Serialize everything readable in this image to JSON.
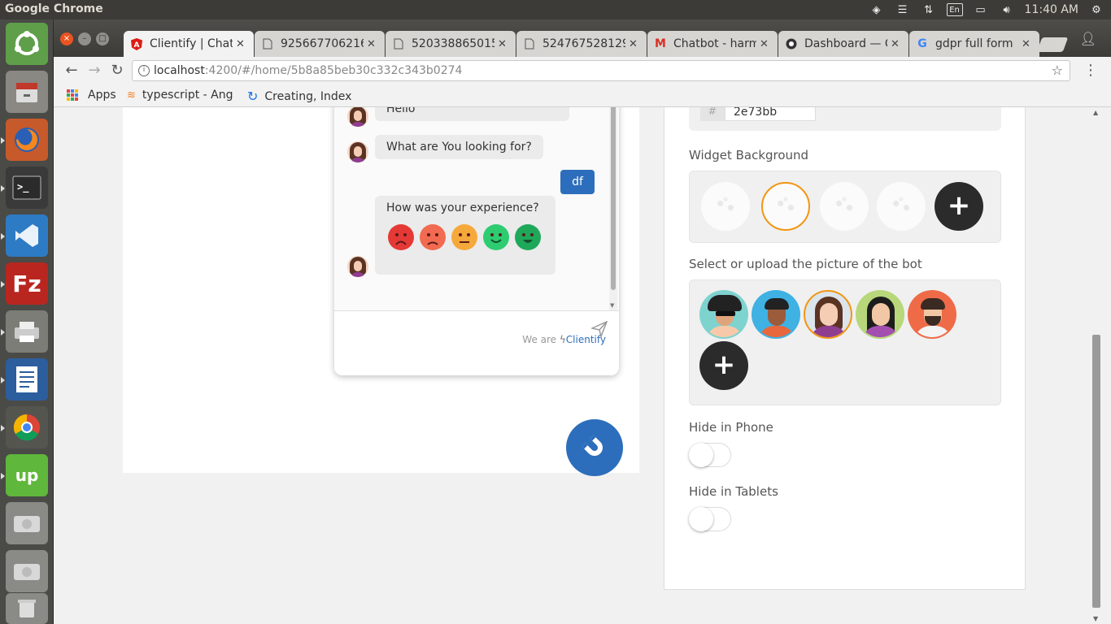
{
  "top_panel": {
    "app_name": "Google Chrome",
    "keyboard_layout": "En",
    "time": "11:40 AM"
  },
  "tabs": [
    {
      "label": "Clientify | Chatb",
      "favicon": "angular-icon",
      "active": true
    },
    {
      "label": "925667706216",
      "favicon": "document-icon",
      "active": false
    },
    {
      "label": "520338865015",
      "favicon": "document-icon",
      "active": false
    },
    {
      "label": "524767528129",
      "favicon": "document-icon",
      "active": false
    },
    {
      "label": "Chatbot - harm",
      "favicon": "gmail-icon",
      "active": false
    },
    {
      "label": "Dashboard — C",
      "favicon": "chat-icon",
      "active": false
    },
    {
      "label": "gdpr full form",
      "favicon": "google-icon",
      "active": false
    }
  ],
  "address_bar": {
    "host": "localhost",
    "rest": ":4200/#/home/5b8a85beb30c332c343b0274"
  },
  "bookmarks": [
    {
      "label": "Apps",
      "icon": "apps-grid-icon"
    },
    {
      "label": "typescript - Ang",
      "icon": "stackoverflow-icon"
    },
    {
      "label": "Creating, Index",
      "icon": "refresh-logo-icon"
    }
  ],
  "chat": {
    "messages": [
      {
        "from": "bot",
        "text": "Hello"
      },
      {
        "from": "bot",
        "text": "What are You looking for?"
      },
      {
        "from": "user",
        "text": "df"
      }
    ],
    "feedback_question": "How was your experience?",
    "emojis": [
      "angry",
      "sad",
      "neutral",
      "happy",
      "very-happy"
    ],
    "powered_prefix": "We are",
    "powered_brand": "Clientify"
  },
  "settings": {
    "color_hash": "#",
    "color_value": "2e73bb",
    "widget_background_label": "Widget Background",
    "bot_picture_label": "Select or upload the picture of the bot",
    "hide_phone_label": "Hide in Phone",
    "hide_tablets_label": "Hide in Tablets",
    "plus_symbol": "+",
    "hide_phone": false,
    "hide_tablets": false
  },
  "colors": {
    "accent": "#2e73bb",
    "selected_ring": "#f29612",
    "ubuntu_orange": "#e95420"
  }
}
